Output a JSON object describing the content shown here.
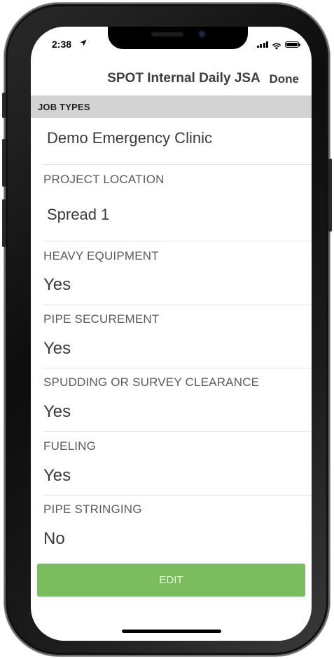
{
  "status_bar": {
    "time": "2:38",
    "location_arrow": "➤"
  },
  "nav": {
    "title": "SPOT Internal Daily JSA",
    "done_label": "Done"
  },
  "section": {
    "header": "JOB TYPES",
    "first_value": "Demo Emergency Clinic"
  },
  "fields": [
    {
      "label": "PROJECT LOCATION",
      "value": "Spread 1"
    },
    {
      "label": "HEAVY EQUIPMENT",
      "value": "Yes"
    },
    {
      "label": "PIPE SECUREMENT",
      "value": "Yes"
    },
    {
      "label": "SPUDDING OR SURVEY CLEARANCE",
      "value": "Yes"
    },
    {
      "label": "FUELING",
      "value": "Yes"
    },
    {
      "label": "PIPE STRINGING",
      "value": "No"
    }
  ],
  "edit_button": {
    "label": "EDIT"
  },
  "colors": {
    "edit_button": "#7bbd5e",
    "section_header": "#d3d3d3"
  },
  "icons": [
    "location-arrow-icon",
    "cellular-signal-icon",
    "wifi-icon",
    "battery-icon"
  ]
}
